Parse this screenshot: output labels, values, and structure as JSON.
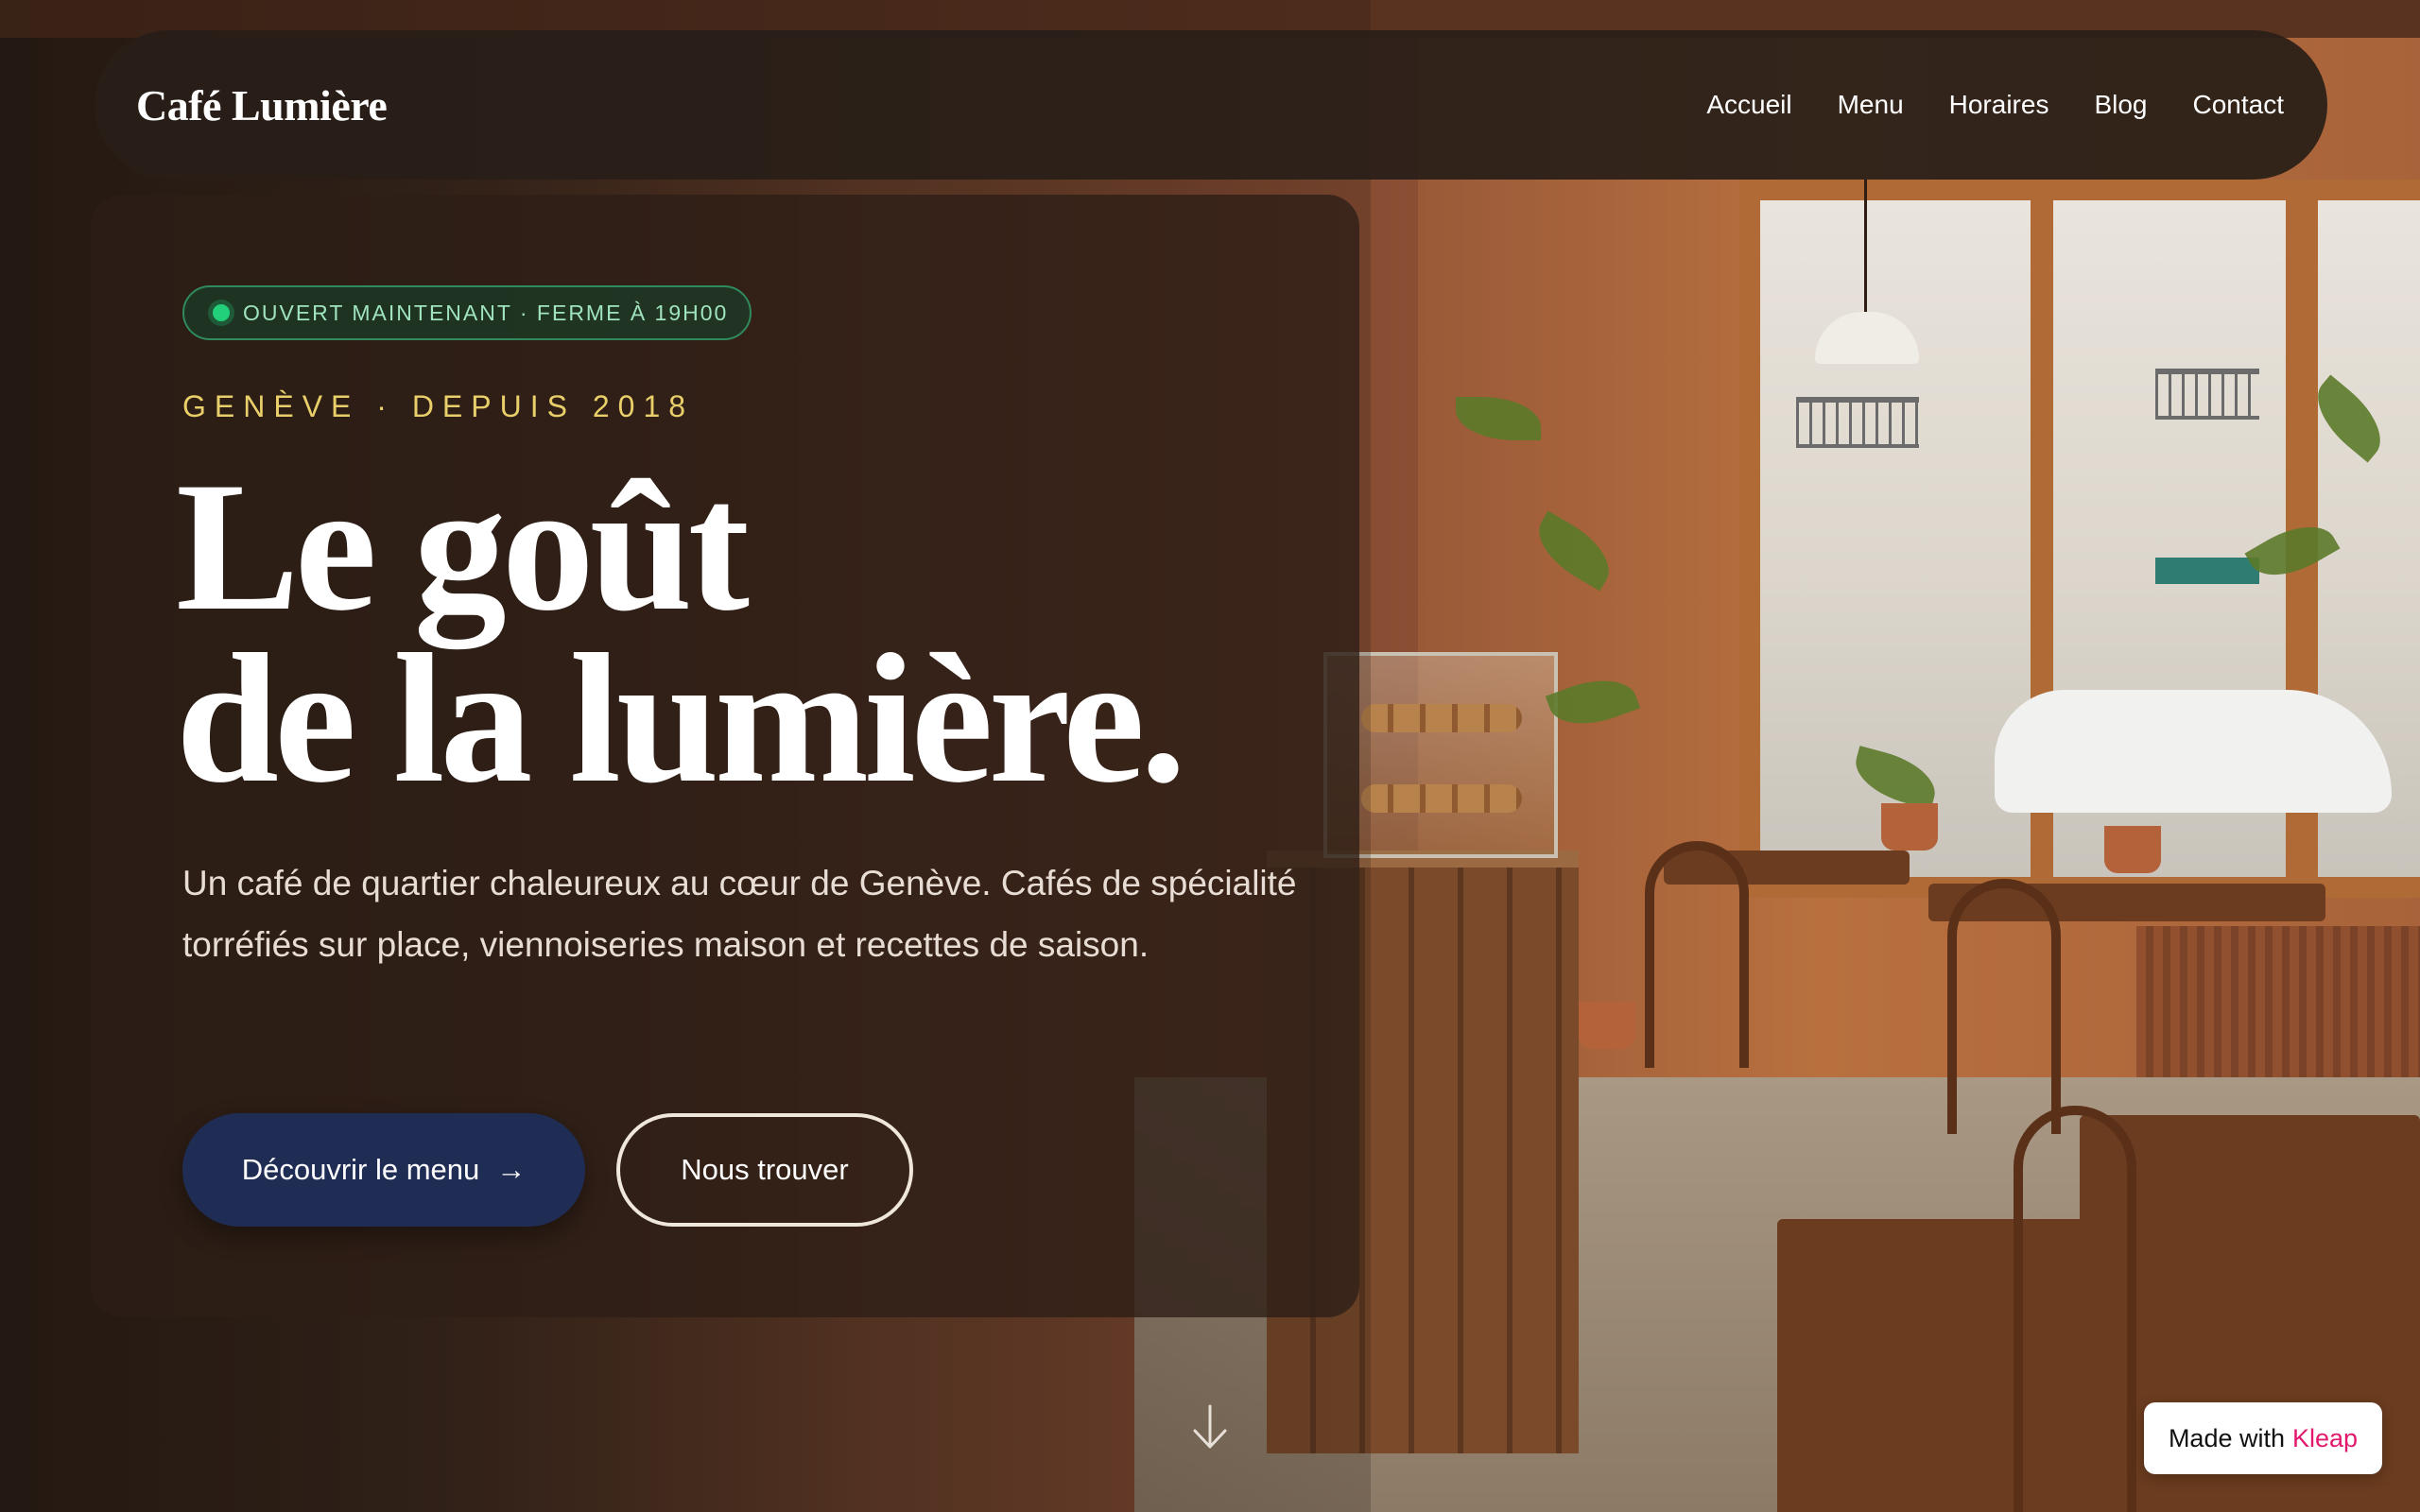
{
  "nav": {
    "brand": "Café Lumière",
    "links": [
      "Accueil",
      "Menu",
      "Horaires",
      "Blog",
      "Contact"
    ]
  },
  "hero": {
    "status": "OUVERT MAINTENANT · FERME À 19H00",
    "kicker": "GENÈVE · DEPUIS 2018",
    "headline_line1": "Le goût",
    "headline_line2": "de la lumière.",
    "lede": "Un café de quartier chaleureux au cœur de Genève. Cafés de spécialité torréfiés sur place, viennoiseries maison et recettes de saison.",
    "primary_button": "Découvrir le menu",
    "primary_button_arrow": "→",
    "secondary_button": "Nous trouver"
  },
  "badge": {
    "prefix": "Made with",
    "brand": "Kleap"
  },
  "colors": {
    "status_dot": "#22d07a",
    "kicker": "#e9cf6a",
    "primary_button": "#1f2d55",
    "badge_accent": "#e2186d"
  },
  "icons": {
    "scroll": "arrow-down-icon",
    "status": "status-dot-icon"
  }
}
